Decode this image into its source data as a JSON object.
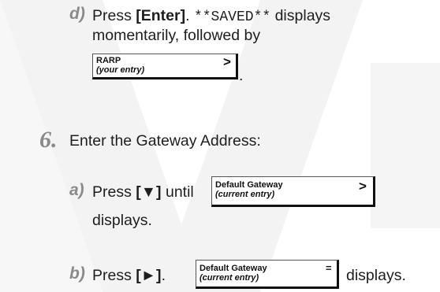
{
  "step_d": {
    "letter": "d)",
    "press": "Press ",
    "key": "[Enter]",
    "after_key": ". ",
    "saved": "**SAVED**",
    "displays": " displays",
    "line2": "momentarily, followed by",
    "lcd": {
      "line1": "RARP",
      "line2": "(your entry)",
      "indicator": ">"
    },
    "end": "."
  },
  "step6": {
    "number": "6.",
    "text": "Enter the Gateway Address:"
  },
  "step_a": {
    "letter": "a)",
    "press": "Press ",
    "key": "[▼]",
    "until": " until",
    "lcd": {
      "line1": "Default Gateway",
      "line2": "(current entry)",
      "indicator": ">"
    },
    "line2": "displays."
  },
  "step_b": {
    "letter": "b)",
    "press": "Press ",
    "key": "[►]",
    "after_key": ".",
    "lcd": {
      "line1": "Default Gateway",
      "line2": "(current entry)",
      "indicator": "="
    },
    "displays": "displays."
  }
}
